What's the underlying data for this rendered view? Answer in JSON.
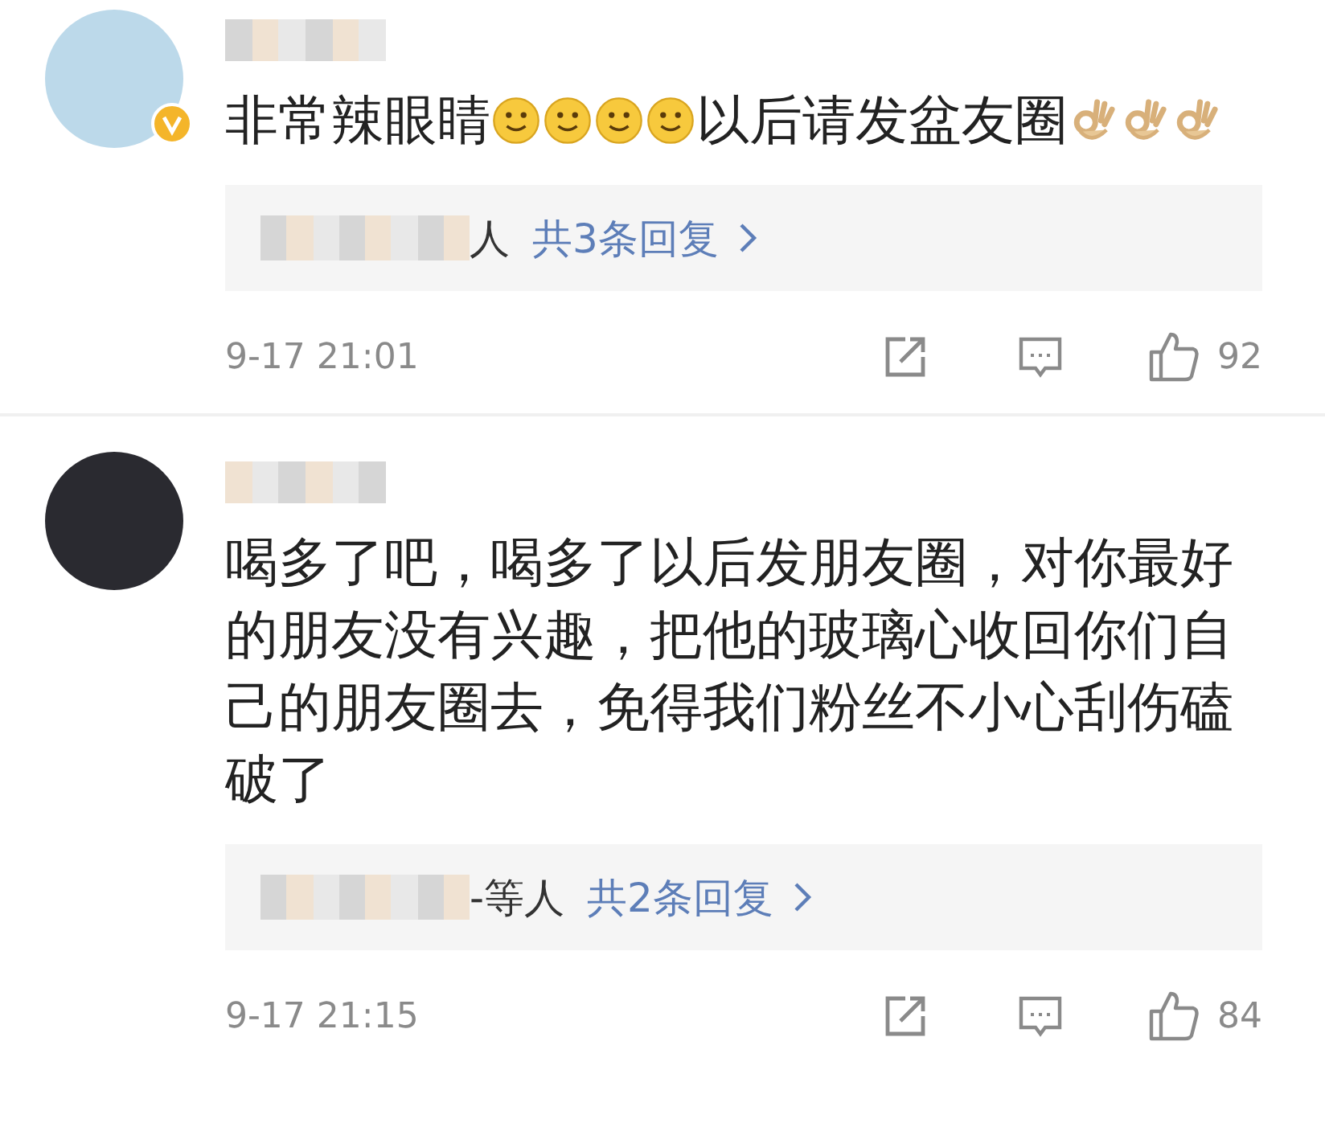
{
  "comments": [
    {
      "verified": true,
      "segments": [
        {
          "kind": "text",
          "text": "非常辣眼睛"
        },
        {
          "kind": "smiley"
        },
        {
          "kind": "smiley"
        },
        {
          "kind": "smiley"
        },
        {
          "kind": "smiley"
        },
        {
          "kind": "text",
          "text": "以后请发盆友圈"
        },
        {
          "kind": "ok-hand"
        },
        {
          "kind": "ok-hand"
        },
        {
          "kind": "ok-hand"
        }
      ],
      "replies": {
        "suffix": "人",
        "link": "共3条回复"
      },
      "time": "9-17 21:01",
      "likes": "92"
    },
    {
      "verified": false,
      "segments": [
        {
          "kind": "text",
          "text": "喝多了吧，喝多了以后发朋友圈，对你最好的朋友没有兴趣，把他的玻璃心收回你们自己的朋友圈去，免得我们粉丝不小心刮伤磕破了"
        }
      ],
      "replies": {
        "suffix": "-等人",
        "link": "共2条回复"
      },
      "time": "9-17 21:15",
      "likes": "84"
    }
  ]
}
